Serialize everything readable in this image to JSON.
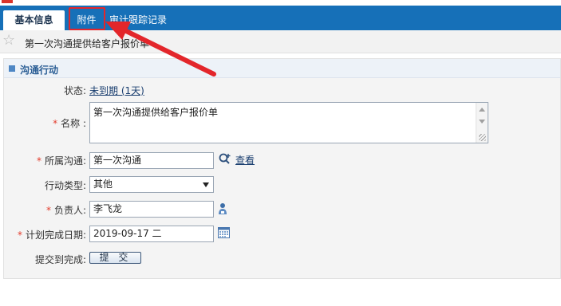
{
  "tabs": {
    "basic": "基本信息",
    "attachment": "附件",
    "audit": "审计跟踪记录"
  },
  "record_title": "第一次沟通提供给客户报价单",
  "section": {
    "title": "沟通行动"
  },
  "form": {
    "status": {
      "label": "状态:",
      "value": "未到期 (1天)"
    },
    "name": {
      "label": "名称 :",
      "value": "第一次沟通提供给客户报价单"
    },
    "belong": {
      "label": "所属沟通:",
      "value": "第一次沟通",
      "view_link": "查看"
    },
    "action_type": {
      "label": "行动类型:",
      "value": "其他"
    },
    "owner": {
      "label": "负责人:",
      "value": "李飞龙"
    },
    "due_date": {
      "label": "计划完成日期:",
      "value": "2019-09-17 二"
    },
    "submit_to_complete": {
      "label": "提交到完成:",
      "button": "提 交"
    }
  },
  "required_marker": "*",
  "colors": {
    "tab_bar": "#1670b8",
    "annotation": "#e3262b",
    "required": "#e33b2b",
    "section_title": "#2b5e95"
  },
  "icons": {
    "favorite": "star-outline",
    "lookup": "magnifier-plus",
    "owner_lookup": "person",
    "date_picker": "calendar"
  }
}
